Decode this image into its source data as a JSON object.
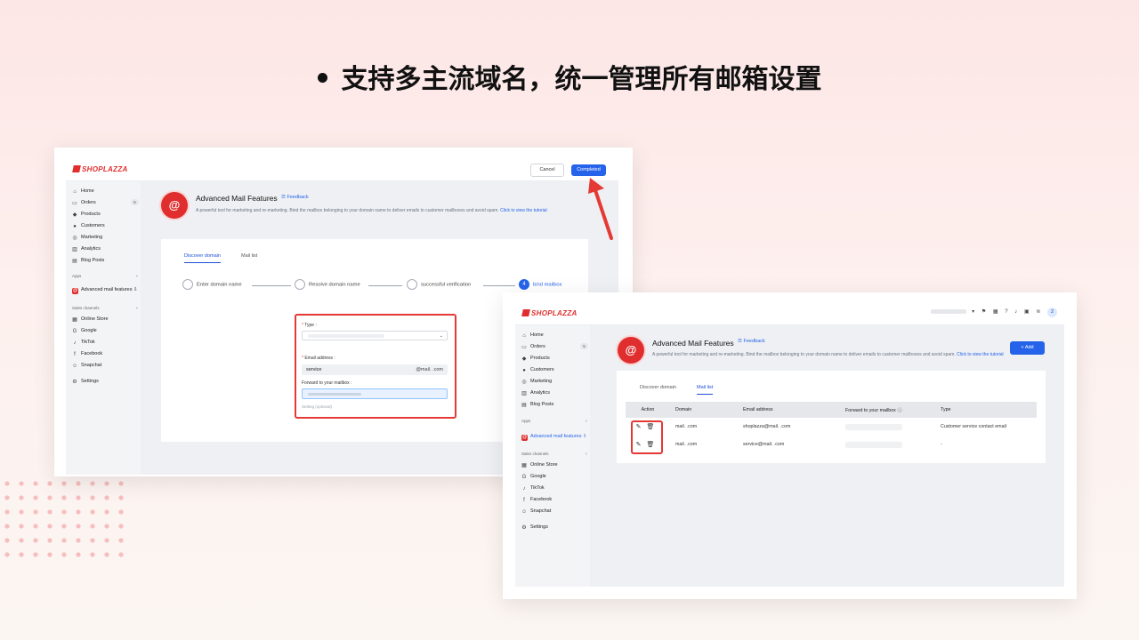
{
  "headline": "支持多主流域名，统一管理所有邮箱设置",
  "brand": "SHOPLAZZA",
  "sidebar": {
    "items": [
      "Home",
      "Orders",
      "Products",
      "Customers",
      "Marketing",
      "Analytics",
      "Blog Posts"
    ],
    "orders_count": "5",
    "apps_label": "Apps",
    "app_item": "Advanced mail features",
    "sales_label": "Sales channels",
    "channels": [
      "Online Store",
      "Google",
      "TikTok",
      "Facebook",
      "Snapchat"
    ],
    "settings": "Settings"
  },
  "feature": {
    "title": "Advanced Mail Features",
    "feedback": "Feedback",
    "desc": "A powerful tool for marketing and re-marketing. Bind the mailbox belonging to your domain name to deliver emails to customer mailboxes and avoid spam.",
    "tutorial": "Click to view the tutorial"
  },
  "screen1": {
    "cancel": "Cancel",
    "completed": "Completed",
    "tabs": [
      "Discover domain",
      "Mail list"
    ],
    "steps": [
      "Enter domain name",
      "Resolve domain name",
      "successful verification",
      "bind mailbox"
    ],
    "current_step_number": "4",
    "form": {
      "type_label": "Type",
      "email_label": "Email address",
      "email_prefix": "service",
      "email_domain": "@mail.          .com",
      "forward_label": "Forward to your mailbox",
      "hint": "Setting (optional)"
    }
  },
  "screen2": {
    "add": "Add",
    "avatar": "2",
    "tabs": [
      "Discover domain",
      "Mail list"
    ],
    "columns": [
      "Action",
      "Domain",
      "Email address",
      "Forward to your mailbox",
      "Type"
    ],
    "rows": [
      {
        "domain": "mail.          .com",
        "email": "shoplazza@mail.          .com",
        "type": "Customer service contact email"
      },
      {
        "domain": "mail.          .com",
        "email": "service@mail.          .com",
        "type": "-"
      }
    ]
  }
}
